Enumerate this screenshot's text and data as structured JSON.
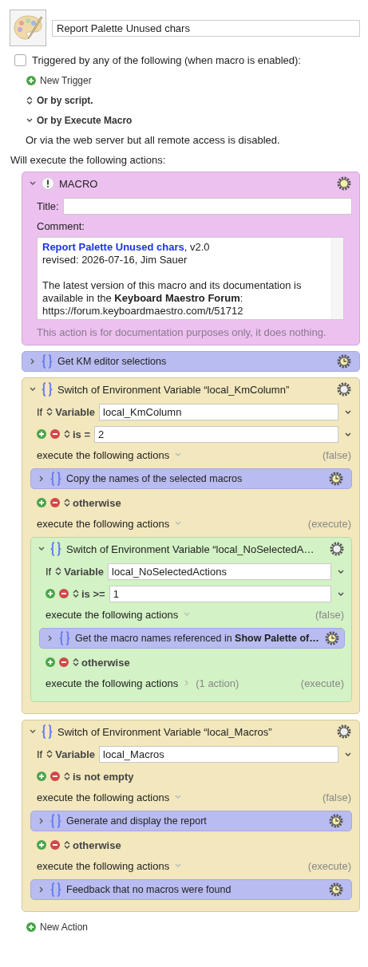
{
  "macro": {
    "name": "Report Palette Unused chars"
  },
  "trigger": {
    "checked": false,
    "label": "Triggered by any of the following (when macro is enabled):"
  },
  "new_trigger": "New Trigger",
  "options": [
    {
      "kind": "popup",
      "label": "Or by script."
    },
    {
      "kind": "disclosure",
      "label": "Or by Execute Macro"
    }
  ],
  "web_server_note": "Or via the web server but all remote access is disabled.",
  "actions_heading": "Will execute the following actions:",
  "actions": [
    {
      "kind": "comment",
      "expanded": true,
      "title": "MACRO",
      "title_label": "Title:",
      "comment_label": "Comment:",
      "comment_link": "Report Palette Unused chars",
      "comment_link_rest": ", v2.0",
      "comment_paragraphs": [
        [
          "revised: 2026-07-16, Jim Sauer"
        ],
        [
          "The latest version of this macro and its documentation is",
          "available in the **Keyboard Maestro Forum**:",
          "https://forum.keyboardmaestro.com/t/51712"
        ]
      ],
      "note": "This action is for documentation purposes only, it does nothing."
    },
    {
      "kind": "group",
      "expanded": false,
      "title": "Get KM editor selections"
    },
    {
      "kind": "switch",
      "expanded": true,
      "title": "Switch of Environment Variable “local_KmColumn”",
      "if_label": "If",
      "source": "Variable",
      "variable": "local_KmColumn",
      "cases": [
        {
          "condition": "is =",
          "value": "2",
          "execute_label": "execute the following actions",
          "status": "(false)",
          "expanded": true,
          "actions": [
            {
              "kind": "group",
              "expanded": false,
              "title": "Copy the names of the selected macros"
            }
          ]
        },
        {
          "condition": "otherwise",
          "execute_label": "execute the following actions",
          "status": "(execute)",
          "expanded": true,
          "actions": [
            {
              "kind": "switch",
              "expanded": true,
              "title": "Switch of Environment Variable “local_NoSelectedA…",
              "if_label": "If",
              "source": "Variable",
              "variable": "local_NoSelectedActions",
              "cases": [
                {
                  "condition": "is >=",
                  "value": "1",
                  "execute_label": "execute the following actions",
                  "status": "(false)",
                  "expanded": true,
                  "actions": [
                    {
                      "kind": "group",
                      "expanded": false,
                      "title": "Get the macro names referenced in **Show Palette of…**"
                    }
                  ]
                },
                {
                  "condition": "otherwise",
                  "execute_label": "execute the following actions",
                  "summary": "(1 action)",
                  "status": "(execute)",
                  "expanded": false
                }
              ]
            }
          ]
        }
      ]
    },
    {
      "kind": "switch",
      "expanded": true,
      "title": "Switch of Environment Variable “local_Macros”",
      "if_label": "If",
      "source": "Variable",
      "variable": "local_Macros",
      "cases": [
        {
          "condition": "is not empty",
          "execute_label": "execute the following actions",
          "status": "(false)",
          "expanded": true,
          "actions": [
            {
              "kind": "group",
              "expanded": false,
              "title": "Generate and display the report"
            }
          ]
        },
        {
          "condition": "otherwise",
          "execute_label": "execute the following actions",
          "status": "(execute)",
          "expanded": true,
          "actions": [
            {
              "kind": "group",
              "expanded": false,
              "title": "Feedback that no macros were found"
            }
          ]
        }
      ]
    }
  ],
  "new_action": "New Action"
}
